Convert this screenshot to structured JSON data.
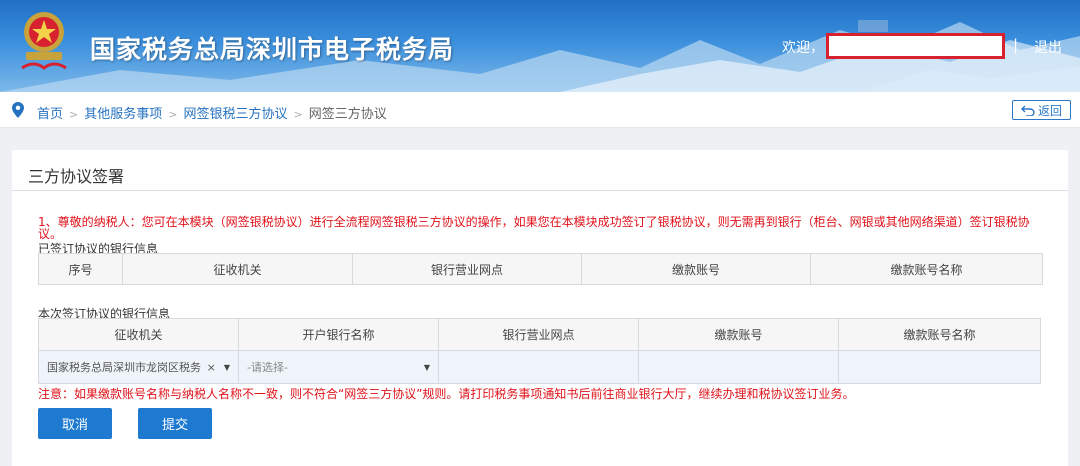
{
  "header": {
    "site_title": "国家税务总局深圳市电子税务局",
    "welcome": "欢迎，",
    "user_name": "",
    "separator": "|",
    "logout": "退出"
  },
  "breadcrumb": {
    "items": [
      "首页",
      "其他服务事项",
      "网签银税三方协议"
    ],
    "current": "网签三方协议",
    "separator": ">",
    "back_label": "返回"
  },
  "panel": {
    "title": "三方协议签署",
    "notice": "1、尊敬的纳税人：您可在本模块（网签银税协议）进行全流程网签银税三方协议的操作，如果您在本模块成功签订了银税协议，则无需再到银行（柜台、网银或其他网络渠道）签订银税协议。"
  },
  "signed_section": {
    "label": "已签订协议的银行信息",
    "columns": [
      "序号",
      "征收机关",
      "银行营业网点",
      "缴款账号",
      "缴款账号名称"
    ]
  },
  "current_section": {
    "label": "本次签订协议的银行信息",
    "columns": [
      "征收机关",
      "开户银行名称",
      "银行营业网点",
      "缴款账号",
      "缴款账号名称"
    ],
    "row": {
      "tax_office": "国家税务总局深圳市龙岗区税务",
      "clear_symbol": "×",
      "bank_placeholder": "-请选择-",
      "branch": "",
      "account": "",
      "account_name": ""
    }
  },
  "warning": "注意：如果缴款账号名称与纳税人名称不一致，则不符合“网签三方协议”规则。请打印税务事项通知书后前往商业银行大厅，继续办理和税协议签订业务。",
  "actions": {
    "cancel": "取消",
    "submit": "提交"
  },
  "colors": {
    "brand_blue": "#1e7ad1",
    "link_blue": "#2672c0",
    "alert_red": "#e0121a",
    "highlight_box": "#d7212f"
  },
  "icons": {
    "emblem": "national-tax-emblem",
    "location": "location-pin-icon",
    "back": "return-arrow-icon",
    "caret": "chevron-down-icon",
    "clear": "close-icon"
  }
}
